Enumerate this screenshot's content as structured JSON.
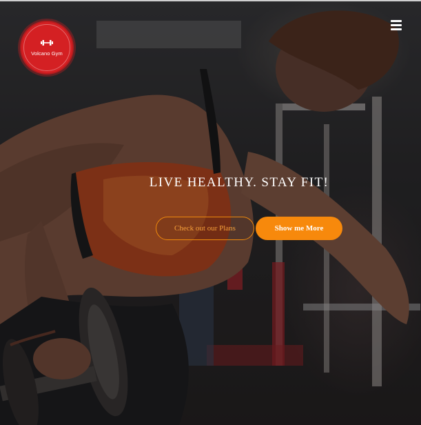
{
  "brand": {
    "name": "Volcano Gym",
    "icon": "dumbbell-icon",
    "logo_color": "#d42023"
  },
  "nav": {
    "menu_icon": "hamburger-menu-icon"
  },
  "hero": {
    "headline": "LIVE HEALTHY. STAY FIT!",
    "primary_button": "Check out our Plans",
    "secondary_button": "Show me More",
    "accent_color": "#f7890c"
  }
}
